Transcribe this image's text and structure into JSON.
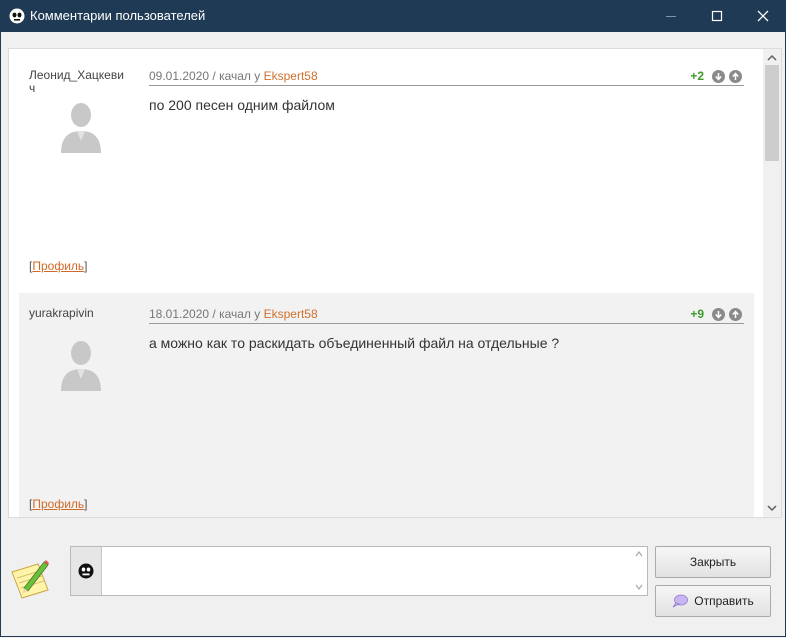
{
  "window": {
    "title": "Комментарии пользователей",
    "icon": "app-logo-icon"
  },
  "comments": [
    {
      "author": "Леонид_Хацкевич",
      "date": "09.01.2020",
      "separator": " / качал у ",
      "source_user": "Ekspert58",
      "score": "+2",
      "text": "по 200 песен одним файлом",
      "profile_open": "[",
      "profile_label": "Профиль",
      "profile_close": "]"
    },
    {
      "author": "yurakrapivin",
      "date": "18.01.2020",
      "separator": " / качал у ",
      "source_user": "Ekspert58",
      "score": "+9",
      "text": "а можно как то раскидать объединенный файл на отдельные ?",
      "profile_open": "[",
      "profile_label": "Профиль",
      "profile_close": "]"
    }
  ],
  "composer": {
    "value": "",
    "placeholder": ""
  },
  "buttons": {
    "close": "Закрыть",
    "send": "Отправить"
  },
  "colors": {
    "titlebar": "#1f3a55",
    "link": "#d0702d",
    "score": "#3d9a2d"
  }
}
